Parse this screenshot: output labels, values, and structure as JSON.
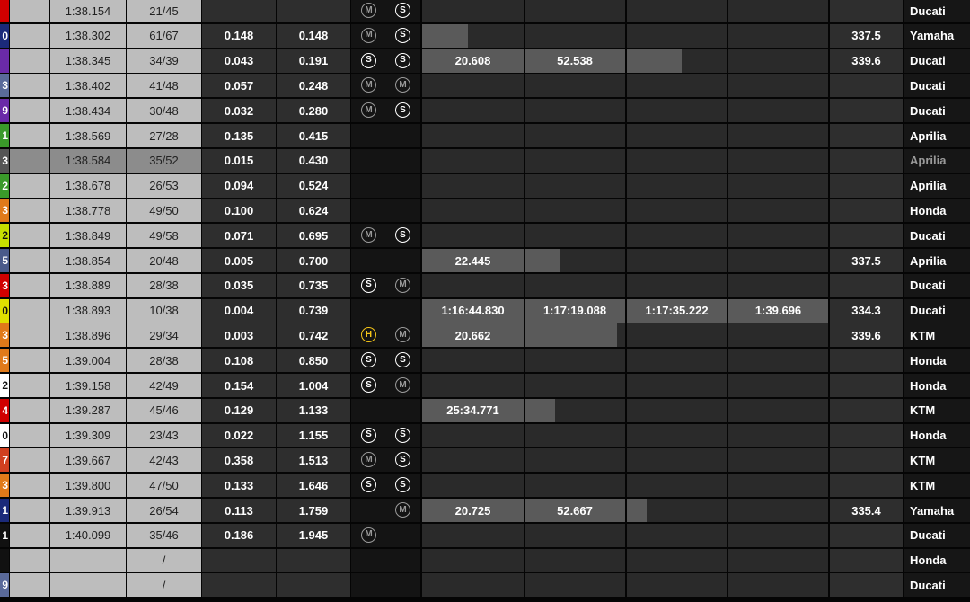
{
  "columns": [
    "",
    "",
    "",
    "",
    "",
    "",
    "",
    "",
    "",
    "",
    "",
    ""
  ],
  "rows": [
    {
      "num": "",
      "num_color": "#d00000",
      "lap": "1:38.154",
      "laps": "21/45",
      "gap": "",
      "lead": "",
      "tyres": [
        "m",
        "s"
      ],
      "s1": "",
      "s2": "",
      "s3": "",
      "s4": "",
      "speed": "",
      "maker": "Ducati",
      "bars": {}
    },
    {
      "num": "0",
      "num_color": "#1b2a7a",
      "lap": "1:38.302",
      "laps": "61/67",
      "gap": "0.148",
      "lead": "0.148",
      "tyres": [
        "m",
        "s"
      ],
      "s1": "",
      "s2": "",
      "s3": "",
      "s4": "",
      "speed": "337.5",
      "maker": "Yamaha",
      "bars": {
        "s1": 0.45
      }
    },
    {
      "num": "",
      "num_color": "#6a2aa8",
      "lap": "1:38.345",
      "laps": "34/39",
      "gap": "0.043",
      "lead": "0.191",
      "tyres": [
        "s",
        "s"
      ],
      "s1": "20.608",
      "s2": "52.538",
      "s3": "",
      "s4": "",
      "speed": "339.6",
      "maker": "Ducati",
      "bars": {
        "s1": 1,
        "s2": 1,
        "s3": 0.55
      }
    },
    {
      "num": "3",
      "num_color": "#5a6a9a",
      "lap": "1:38.402",
      "laps": "41/48",
      "gap": "0.057",
      "lead": "0.248",
      "tyres": [
        "m",
        "m"
      ],
      "s1": "",
      "s2": "",
      "s3": "",
      "s4": "",
      "speed": "",
      "maker": "Ducati",
      "bars": {}
    },
    {
      "num": "9",
      "num_color": "#6a2aa8",
      "lap": "1:38.434",
      "laps": "30/48",
      "gap": "0.032",
      "lead": "0.280",
      "tyres": [
        "m",
        "s"
      ],
      "s1": "",
      "s2": "",
      "s3": "",
      "s4": "",
      "speed": "",
      "maker": "Ducati",
      "bars": {}
    },
    {
      "num": "1",
      "num_color": "#3a9a2a",
      "lap": "1:38.569",
      "laps": "27/28",
      "gap": "0.135",
      "lead": "0.415",
      "tyres": [],
      "s1": "",
      "s2": "",
      "s3": "",
      "s4": "",
      "speed": "",
      "maker": "Aprilia",
      "bars": {}
    },
    {
      "num": "3",
      "num_color": "#555555",
      "lap": "1:38.584",
      "laps": "35/52",
      "gap": "0.015",
      "lead": "0.430",
      "tyres": [],
      "s1": "",
      "s2": "",
      "s3": "",
      "s4": "",
      "speed": "",
      "maker": "Aprilia",
      "bars": {},
      "dim": true
    },
    {
      "num": "2",
      "num_color": "#3a9a2a",
      "lap": "1:38.678",
      "laps": "26/53",
      "gap": "0.094",
      "lead": "0.524",
      "tyres": [],
      "s1": "",
      "s2": "",
      "s3": "",
      "s4": "",
      "speed": "",
      "maker": "Aprilia",
      "bars": {}
    },
    {
      "num": "3",
      "num_color": "#e07a1a",
      "lap": "1:38.778",
      "laps": "49/50",
      "gap": "0.100",
      "lead": "0.624",
      "tyres": [],
      "s1": "",
      "s2": "",
      "s3": "",
      "s4": "",
      "speed": "",
      "maker": "Honda",
      "bars": {}
    },
    {
      "num": "2",
      "num_color": "#c8e000",
      "lap": "1:38.849",
      "laps": "49/58",
      "gap": "0.071",
      "lead": "0.695",
      "tyres": [
        "m",
        "s"
      ],
      "s1": "",
      "s2": "",
      "s3": "",
      "s4": "",
      "speed": "",
      "maker": "Ducati",
      "bars": {}
    },
    {
      "num": "5",
      "num_color": "#4a5a8a",
      "lap": "1:38.854",
      "laps": "20/48",
      "gap": "0.005",
      "lead": "0.700",
      "tyres": [],
      "s1": "22.445",
      "s2": "",
      "s3": "",
      "s4": "",
      "speed": "337.5",
      "maker": "Aprilia",
      "bars": {
        "s1": 1,
        "s2": 0.35
      }
    },
    {
      "num": "3",
      "num_color": "#d00000",
      "lap": "1:38.889",
      "laps": "28/38",
      "gap": "0.035",
      "lead": "0.735",
      "tyres": [
        "s",
        "m"
      ],
      "s1": "",
      "s2": "",
      "s3": "",
      "s4": "",
      "speed": "",
      "maker": "Ducati",
      "bars": {}
    },
    {
      "num": "0",
      "num_color": "#e0e000",
      "lap": "1:38.893",
      "laps": "10/38",
      "gap": "0.004",
      "lead": "0.739",
      "tyres": [],
      "s1": "1:16:44.830",
      "s2": "1:17:19.088",
      "s3": "1:17:35.222",
      "s4": "1:39.696",
      "speed": "334.3",
      "maker": "Ducati",
      "bars": {
        "s1": 1,
        "s2": 1,
        "s3": 1,
        "s4": 1
      }
    },
    {
      "num": "3",
      "num_color": "#e07a1a",
      "lap": "1:38.896",
      "laps": "29/34",
      "gap": "0.003",
      "lead": "0.742",
      "tyres": [
        "h",
        "m"
      ],
      "s1": "20.662",
      "s2": "",
      "s3": "",
      "s4": "",
      "speed": "339.6",
      "maker": "KTM",
      "bars": {
        "s1": 1,
        "s2": 0.92
      }
    },
    {
      "num": "5",
      "num_color": "#e07a1a",
      "lap": "1:39.004",
      "laps": "28/38",
      "gap": "0.108",
      "lead": "0.850",
      "tyres": [
        "s",
        "s"
      ],
      "s1": "",
      "s2": "",
      "s3": "",
      "s4": "",
      "speed": "",
      "maker": "Honda",
      "bars": {}
    },
    {
      "num": "2",
      "num_color": "#ffffff",
      "lap": "1:39.158",
      "laps": "42/49",
      "gap": "0.154",
      "lead": "1.004",
      "tyres": [
        "s",
        "m"
      ],
      "s1": "",
      "s2": "",
      "s3": "",
      "s4": "",
      "speed": "",
      "maker": "Honda",
      "bars": {}
    },
    {
      "num": "4",
      "num_color": "#d00000",
      "lap": "1:39.287",
      "laps": "45/46",
      "gap": "0.129",
      "lead": "1.133",
      "tyres": [],
      "s1": "25:34.771",
      "s2": "",
      "s3": "",
      "s4": "",
      "speed": "",
      "maker": "KTM",
      "bars": {
        "s1": 1,
        "s2": 0.3
      }
    },
    {
      "num": "0",
      "num_color": "#ffffff",
      "lap": "1:39.309",
      "laps": "23/43",
      "gap": "0.022",
      "lead": "1.155",
      "tyres": [
        "s",
        "s"
      ],
      "s1": "",
      "s2": "",
      "s3": "",
      "s4": "",
      "speed": "",
      "maker": "Honda",
      "bars": {}
    },
    {
      "num": "7",
      "num_color": "#d04020",
      "lap": "1:39.667",
      "laps": "42/43",
      "gap": "0.358",
      "lead": "1.513",
      "tyres": [
        "m",
        "s"
      ],
      "s1": "",
      "s2": "",
      "s3": "",
      "s4": "",
      "speed": "",
      "maker": "KTM",
      "bars": {}
    },
    {
      "num": "3",
      "num_color": "#e07a1a",
      "lap": "1:39.800",
      "laps": "47/50",
      "gap": "0.133",
      "lead": "1.646",
      "tyres": [
        "s",
        "s"
      ],
      "s1": "",
      "s2": "",
      "s3": "",
      "s4": "",
      "speed": "",
      "maker": "KTM",
      "bars": {}
    },
    {
      "num": "1",
      "num_color": "#1b2a7a",
      "lap": "1:39.913",
      "laps": "26/54",
      "gap": "0.113",
      "lead": "1.759",
      "tyres": [
        "",
        "m"
      ],
      "s1": "20.725",
      "s2": "52.667",
      "s3": "",
      "s4": "",
      "speed": "335.4",
      "maker": "Yamaha",
      "bars": {
        "s1": 1,
        "s2": 1,
        "s3": 0.2
      }
    },
    {
      "num": "1",
      "num_color": "#111111",
      "lap": "1:40.099",
      "laps": "35/46",
      "gap": "0.186",
      "lead": "1.945",
      "tyres": [
        "m"
      ],
      "s1": "",
      "s2": "",
      "s3": "",
      "s4": "",
      "speed": "",
      "maker": "Ducati",
      "bars": {}
    },
    {
      "num": "",
      "num_color": "#111111",
      "lap": "",
      "laps": "/",
      "gap": "",
      "lead": "",
      "tyres": [],
      "s1": "",
      "s2": "",
      "s3": "",
      "s4": "",
      "speed": "",
      "maker": "Honda",
      "bars": {}
    },
    {
      "num": "9",
      "num_color": "#5a6a9a",
      "lap": "",
      "laps": "/",
      "gap": "",
      "lead": "",
      "tyres": [],
      "s1": "",
      "s2": "",
      "s3": "",
      "s4": "",
      "speed": "",
      "maker": "Ducati",
      "bars": {}
    }
  ],
  "tyre_labels": {
    "s": "S",
    "m": "M",
    "h": "H"
  }
}
